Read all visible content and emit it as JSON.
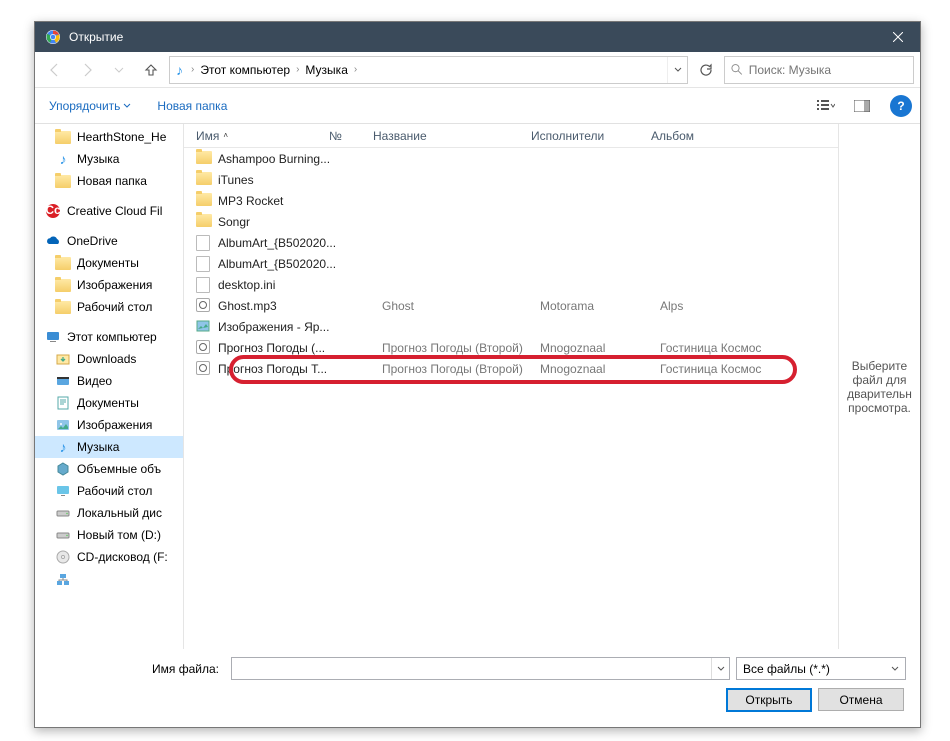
{
  "title": "Открытие",
  "breadcrumb": {
    "seg1": "Этот компьютер",
    "seg2": "Музыка"
  },
  "search_placeholder": "Поиск: Музыка",
  "toolbar": {
    "organize": "Упорядочить",
    "newfolder": "Новая папка"
  },
  "tree": [
    {
      "icon": "folder",
      "label": "HearthStone_He",
      "lvl": 2
    },
    {
      "icon": "music",
      "label": "Музыка",
      "lvl": 2
    },
    {
      "icon": "folder",
      "label": "Новая папка",
      "lvl": 2
    },
    {
      "icon": "cc",
      "label": "Creative Cloud Fil",
      "lvl": 1,
      "spacer_before": true
    },
    {
      "icon": "onedrive",
      "label": "OneDrive",
      "lvl": 1,
      "spacer_before": true
    },
    {
      "icon": "folder",
      "label": "Документы",
      "lvl": 2
    },
    {
      "icon": "folder",
      "label": "Изображения",
      "lvl": 2
    },
    {
      "icon": "folder",
      "label": "Рабочий стол",
      "lvl": 2
    },
    {
      "icon": "pc",
      "label": "Этот компьютер",
      "lvl": 1,
      "spacer_before": true
    },
    {
      "icon": "downloads",
      "label": "Downloads",
      "lvl": 2
    },
    {
      "icon": "video",
      "label": "Видео",
      "lvl": 2
    },
    {
      "icon": "docs",
      "label": "Документы",
      "lvl": 2
    },
    {
      "icon": "images",
      "label": "Изображения",
      "lvl": 2
    },
    {
      "icon": "music",
      "label": "Музыка",
      "lvl": 2,
      "sel": true
    },
    {
      "icon": "cube",
      "label": "Объемные объ",
      "lvl": 2
    },
    {
      "icon": "desktop",
      "label": "Рабочий стол",
      "lvl": 2
    },
    {
      "icon": "drive",
      "label": "Локальный дис",
      "lvl": 2
    },
    {
      "icon": "drive",
      "label": "Новый том (D:)",
      "lvl": 2
    },
    {
      "icon": "cd",
      "label": "CD-дисковод (F:",
      "lvl": 2
    }
  ],
  "columns": {
    "name": "Имя",
    "num": "№",
    "title": "Название",
    "artist": "Исполнители",
    "album": "Альбом"
  },
  "files": [
    {
      "icon": "folder",
      "name": "Ashampoo Burning..."
    },
    {
      "icon": "folder",
      "name": "iTunes"
    },
    {
      "icon": "folder",
      "name": "MP3 Rocket"
    },
    {
      "icon": "folder",
      "name": "Songr"
    },
    {
      "icon": "file",
      "name": "AlbumArt_{B502020..."
    },
    {
      "icon": "file",
      "name": "AlbumArt_{B502020..."
    },
    {
      "icon": "file",
      "name": "desktop.ini"
    },
    {
      "icon": "mp3",
      "name": "Ghost.mp3",
      "title": "Ghost",
      "artist": "Motorama",
      "album": "Alps"
    },
    {
      "icon": "img",
      "name": "Изображения - Яр..."
    },
    {
      "icon": "mp3",
      "name": "Прогноз Погоды (...",
      "title": "Прогноз Погоды (Второй)",
      "artist": "Mnogoznaal",
      "album": "Гостиница Космос"
    },
    {
      "icon": "mp3",
      "name": "Прогноз Погоды Т...",
      "title": "Прогноз Погоды (Второй)",
      "artist": "Mnogoznaal",
      "album": "Гостиница Космос"
    }
  ],
  "preview_text": "Выберите файл для дварительн просмотра.",
  "filename_label": "Имя файла:",
  "filter": "Все файлы (*.*)",
  "open_btn": "Открыть",
  "cancel_btn": "Отмена"
}
